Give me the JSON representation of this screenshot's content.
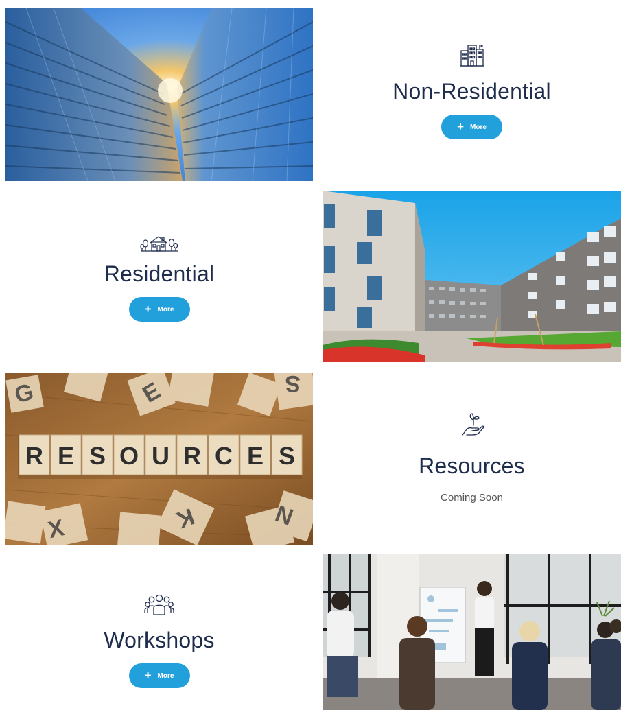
{
  "cards": [
    {
      "title": "Non-Residential",
      "icon": "building-icon",
      "button_label": "More",
      "image": "glass-skyscrapers-photo"
    },
    {
      "title": "Residential",
      "icon": "house-icon",
      "button_label": "More",
      "image": "apartment-courtyard-photo"
    },
    {
      "title": "Resources",
      "icon": "hand-plant-icon",
      "status": "Coming Soon",
      "image": "resources-wooden-blocks-photo",
      "blocks_text": "RESOURCES"
    },
    {
      "title": "Workshops",
      "icon": "people-group-icon",
      "button_label": "More",
      "image": "workshop-meeting-photo"
    }
  ],
  "colors": {
    "title": "#1f2d4d",
    "button": "#22a0dc",
    "button_text": "#ffffff",
    "status": "#555555"
  }
}
